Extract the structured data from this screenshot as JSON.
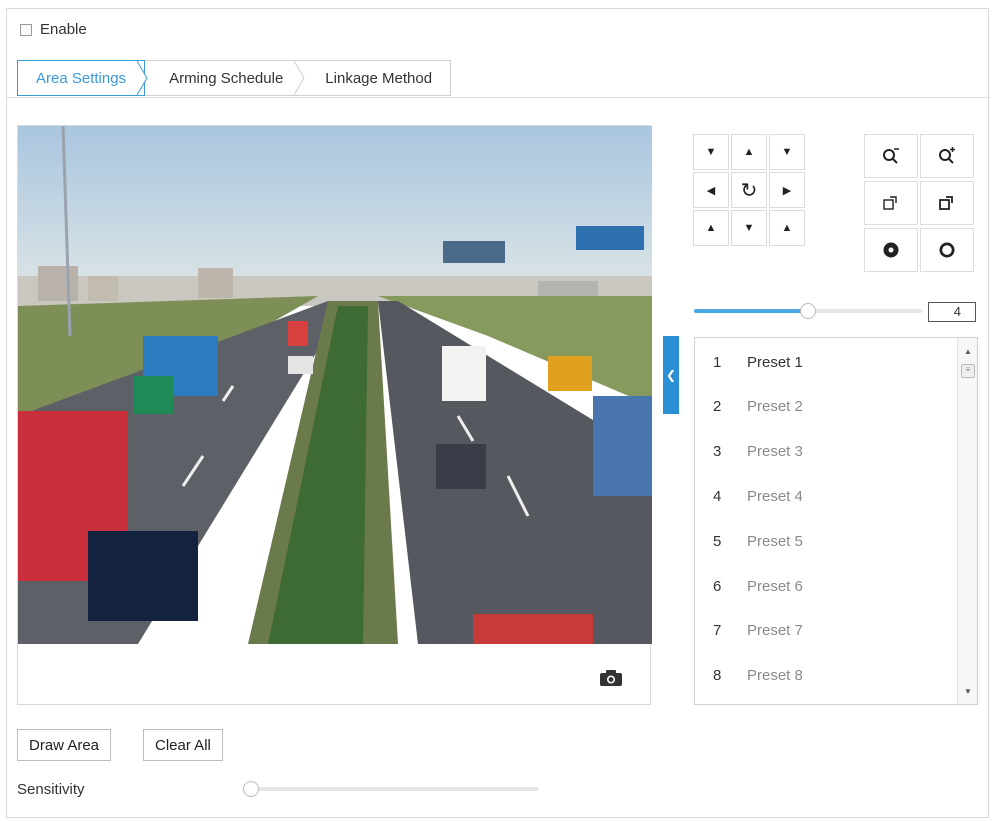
{
  "enable": {
    "label": "Enable",
    "checked": false
  },
  "tabs": [
    {
      "label": "Area Settings",
      "active": true
    },
    {
      "label": "Arming Schedule",
      "active": false
    },
    {
      "label": "Linkage Method",
      "active": false
    }
  ],
  "ptz": {
    "directions": [
      "down-left-arrow",
      "up-arrow",
      "down-right-arrow",
      "left-arrow",
      "auto-rotate-icon",
      "right-arrow",
      "up-left-arrow",
      "down-arrow",
      "up-right-arrow"
    ],
    "lens": [
      "zoom-out-icon",
      "zoom-in-icon",
      "focus-near-icon",
      "focus-far-icon",
      "iris-close-icon",
      "iris-open-icon"
    ],
    "speed_value": "4",
    "speed_fraction": 0.5
  },
  "presets": [
    {
      "number": "1",
      "name": "Preset 1"
    },
    {
      "number": "2",
      "name": "Preset 2"
    },
    {
      "number": "3",
      "name": "Preset 3"
    },
    {
      "number": "4",
      "name": "Preset 4"
    },
    {
      "number": "5",
      "name": "Preset 5"
    },
    {
      "number": "6",
      "name": "Preset 6"
    },
    {
      "number": "7",
      "name": "Preset 7"
    },
    {
      "number": "8",
      "name": "Preset 8"
    }
  ],
  "buttons": {
    "draw_area": "Draw Area",
    "clear_all": "Clear All"
  },
  "sensitivity": {
    "label": "Sensitivity",
    "value_fraction": 0.0
  },
  "colors": {
    "accent": "#3b9ad8",
    "toggle": "#2b8fd6"
  },
  "icons": {
    "camera": "camera-icon",
    "side_toggle": "chevron-left-icon"
  }
}
